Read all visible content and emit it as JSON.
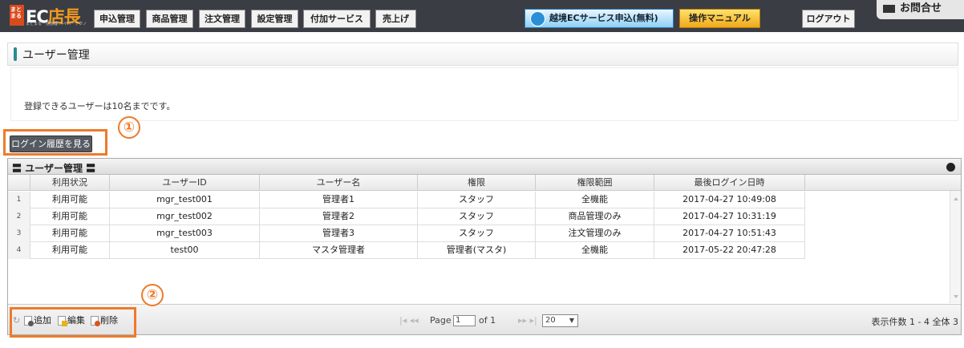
{
  "header": {
    "logo_badge": "まとまる",
    "logo_main": "EC",
    "logo_accent": "店長",
    "logo_sub": "まとまる一括管理 ハイパーテクノ",
    "nav": [
      "申込管理",
      "商品管理",
      "注文管理",
      "設定管理",
      "付加サービス",
      "売上げ"
    ],
    "global_service": "越境ECサービス申込(無料)",
    "manual": "操作マニュアル",
    "logout": "ログアウト",
    "contact": "お問合せ"
  },
  "page": {
    "title": "ユーザー管理",
    "info": "登録できるユーザーは10名までです。",
    "history_button": "ログイン履歴を見る",
    "callout1": "①",
    "callout2": "②"
  },
  "grid": {
    "title": "〓 ユーザー管理 〓",
    "columns": [
      "利用状況",
      "ユーザーID",
      "ユーザー名",
      "権限",
      "権限範囲",
      "最後ログイン日時"
    ],
    "rows": [
      {
        "num": "1",
        "status": "利用可能",
        "id": "mgr_test001",
        "name": "管理者1",
        "role": "スタッフ",
        "scope": "全機能",
        "last": "2017-04-27 10:49:08"
      },
      {
        "num": "2",
        "status": "利用可能",
        "id": "mgr_test002",
        "name": "管理者2",
        "role": "スタッフ",
        "scope": "商品管理のみ",
        "last": "2017-04-27 10:31:19"
      },
      {
        "num": "3",
        "status": "利用可能",
        "id": "mgr_test003",
        "name": "管理者3",
        "role": "スタッフ",
        "scope": "注文管理のみ",
        "last": "2017-04-27 10:51:43"
      },
      {
        "num": "4",
        "status": "利用可能",
        "id": "test00",
        "name": "マスタ管理者",
        "role": "管理者(マスタ)",
        "scope": "全機能",
        "last": "2017-05-22 20:47:28"
      }
    ],
    "footer": {
      "add": "追加",
      "edit": "編集",
      "delete": "削除",
      "page_label": "Page",
      "page_value": "1",
      "of_label": "of 1",
      "page_size": "20",
      "count": "表示件数 1 - 4 全体 3"
    }
  }
}
